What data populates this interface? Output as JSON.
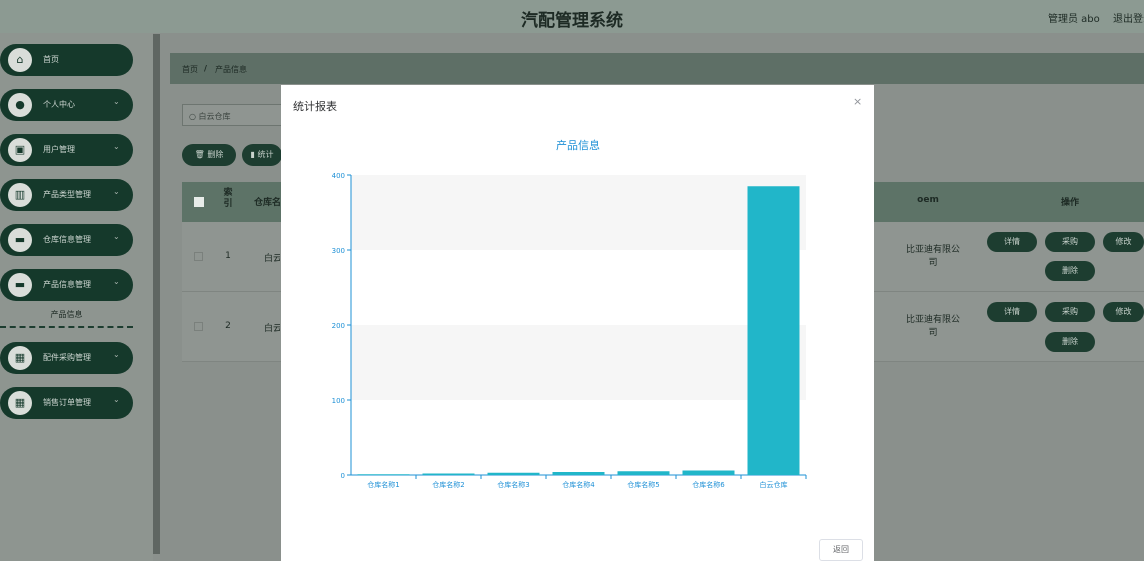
{
  "header": {
    "title": "汽配管理系统",
    "admin": "管理员 abo",
    "logout": "退出登录"
  },
  "sidebar": {
    "items": [
      {
        "label": "首页",
        "icon": "home-icon",
        "glyph": "⌂"
      },
      {
        "label": "个人中心",
        "icon": "user-icon",
        "glyph": "●"
      },
      {
        "label": "用户管理",
        "icon": "user-manage-icon",
        "glyph": "▣"
      },
      {
        "label": "产品类型管理",
        "icon": "product-type-icon",
        "glyph": "▥"
      },
      {
        "label": "仓库信息管理",
        "icon": "warehouse-icon",
        "glyph": "▬"
      },
      {
        "label": "产品信息管理",
        "icon": "product-info-icon",
        "glyph": "▬"
      },
      {
        "label": "配件采购管理",
        "icon": "purchase-icon",
        "glyph": "▦"
      },
      {
        "label": "销售订单管理",
        "icon": "order-icon",
        "glyph": "▦"
      }
    ],
    "submenu_label": "产品信息"
  },
  "breadcrumb": {
    "home": "首页",
    "sep": "/",
    "current": "产品信息"
  },
  "search": {
    "value": "白云仓库"
  },
  "toolbar": {
    "delete": "删除",
    "stats": "统计"
  },
  "table": {
    "headers": {
      "index": "索引",
      "warehouse": "仓库名称",
      "oem": "oem",
      "actions": "操作"
    },
    "rows": [
      {
        "index": "1",
        "warehouse": "白云仓库",
        "oem": "比亚迪有限公司"
      },
      {
        "index": "2",
        "warehouse": "白云仓库",
        "oem": "比亚迪有限公司"
      }
    ],
    "actions": {
      "detail": "详情",
      "purchase": "采购",
      "edit": "修改",
      "delete": "删除"
    }
  },
  "modal": {
    "title": "统计报表",
    "close": "×",
    "back": "返回"
  },
  "chart_data": {
    "type": "bar",
    "title": "产品信息",
    "categories": [
      "仓库名称1",
      "仓库名称2",
      "仓库名称3",
      "仓库名称4",
      "仓库名称5",
      "仓库名称6",
      "白云仓库"
    ],
    "values": [
      1,
      2,
      3,
      4,
      5,
      6,
      385
    ],
    "ylim": [
      0,
      400
    ],
    "yticks": [
      0,
      100,
      200,
      300,
      400
    ],
    "bar_color": "#21b6c9",
    "axis_color": "#1e90d6",
    "band_color": "#f6f6f6"
  }
}
